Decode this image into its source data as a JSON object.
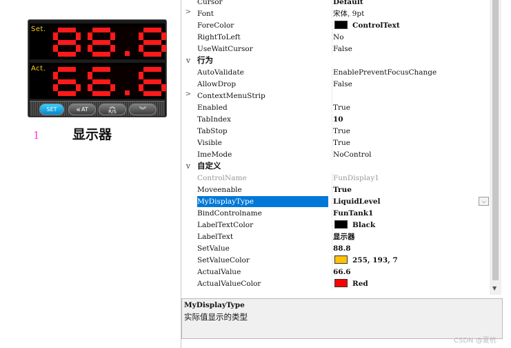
{
  "designer": {
    "display_control": {
      "set_label": "Set.",
      "act_label": "Act.",
      "set_value": "88.8",
      "actual_value": "66.6",
      "buttons": [
        {
          "label": "SET"
        },
        {
          "label": "AT"
        },
        {
          "label": "R/S"
        },
        {
          "label": "▼▼"
        }
      ]
    },
    "control_caption": "显示器",
    "control_index": "1"
  },
  "property_grid": {
    "rows": [
      {
        "kind": "prop",
        "expander": "",
        "name": "Cursor",
        "value": "Default",
        "bold": true
      },
      {
        "kind": "prop",
        "expander": ">",
        "name": "Font",
        "value": "宋体, 9pt"
      },
      {
        "kind": "prop",
        "expander": "",
        "name": "ForeColor",
        "value": "ControlText",
        "bold": true,
        "swatch": "#000000"
      },
      {
        "kind": "prop",
        "expander": "",
        "name": "RightToLeft",
        "value": "No"
      },
      {
        "kind": "prop",
        "expander": "",
        "name": "UseWaitCursor",
        "value": "False"
      },
      {
        "kind": "cat",
        "expander": "v",
        "title": "行为"
      },
      {
        "kind": "prop",
        "expander": "",
        "name": "AutoValidate",
        "value": "EnablePreventFocusChange"
      },
      {
        "kind": "prop",
        "expander": "",
        "name": "AllowDrop",
        "value": "False"
      },
      {
        "kind": "prop",
        "expander": ">",
        "name": "ContextMenuStrip",
        "value": ""
      },
      {
        "kind": "prop",
        "expander": "",
        "name": "Enabled",
        "value": "True"
      },
      {
        "kind": "prop",
        "expander": "",
        "name": "TabIndex",
        "value": "10",
        "bold": true
      },
      {
        "kind": "prop",
        "expander": "",
        "name": "TabStop",
        "value": "True"
      },
      {
        "kind": "prop",
        "expander": "",
        "name": "Visible",
        "value": "True"
      },
      {
        "kind": "prop",
        "expander": "",
        "name": "ImeMode",
        "value": "NoControl"
      },
      {
        "kind": "cat",
        "expander": "v",
        "title": "自定义"
      },
      {
        "kind": "prop",
        "expander": "",
        "name": "ControlName",
        "value": "FunDisplay1",
        "dim": true
      },
      {
        "kind": "prop",
        "expander": "",
        "name": "Moveenable",
        "value": "True",
        "bold": true
      },
      {
        "kind": "prop",
        "expander": "",
        "name": "MyDisplayType",
        "value": "LiquidLevel",
        "bold": true,
        "selected": true
      },
      {
        "kind": "prop",
        "expander": "",
        "name": "BindControlname",
        "value": "FunTank1",
        "bold": true
      },
      {
        "kind": "prop",
        "expander": "",
        "name": "LabelTextColor",
        "value": "Black",
        "bold": true,
        "swatch": "#000000"
      },
      {
        "kind": "prop",
        "expander": "",
        "name": "LabelText",
        "value": "显示器",
        "bold": true
      },
      {
        "kind": "prop",
        "expander": "",
        "name": "SetValue",
        "value": "88.8",
        "bold": true
      },
      {
        "kind": "prop",
        "expander": "",
        "name": "SetValueColor",
        "value": "255, 193, 7",
        "bold": true,
        "swatch": "#ffc107"
      },
      {
        "kind": "prop",
        "expander": "",
        "name": "ActualValue",
        "value": "66.6",
        "bold": true
      },
      {
        "kind": "prop",
        "expander": "",
        "name": "ActualValueColor",
        "value": "Red",
        "bold": true,
        "swatch": "#ff0000"
      }
    ],
    "description": {
      "title": "MyDisplayType",
      "text": "实际值显示的类型"
    }
  },
  "watermark": "CSDN @夏杭",
  "colors": {
    "selection": "#0078d7",
    "segment": "#ff1a1a",
    "label_yellow": "#ffd21a"
  }
}
